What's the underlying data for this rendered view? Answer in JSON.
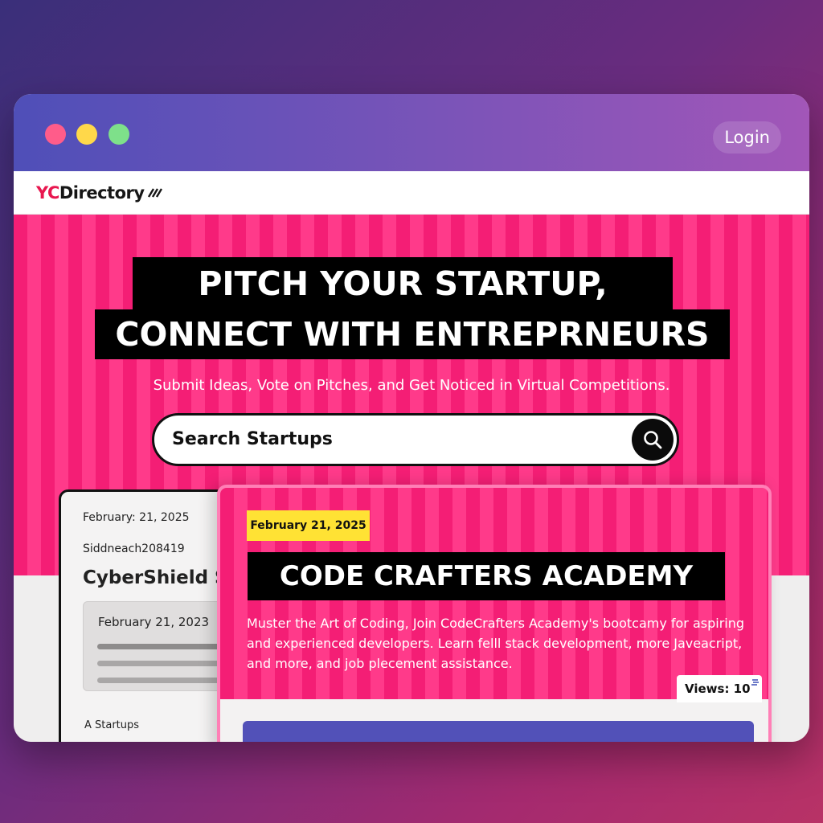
{
  "window": {
    "login_label": "Login"
  },
  "navbar": {
    "logo_yc": "YC",
    "logo_rest": "Directory"
  },
  "hero": {
    "headline_line1": "PITCH YOUR STARTUP,",
    "headline_line2": "CONNECT WITH ENTREPRNEURS",
    "subtitle": "Submit Ideas, Vote on Pitches, and Get Noticed in Virtual Competitions.",
    "search_placeholder": "Search Startups",
    "search_icon": "search-icon"
  },
  "cards": {
    "left": {
      "date": "February: 21, 2025",
      "author": "Siddneach208419",
      "title": "CyberShield S",
      "inner_date": "February 21, 2023",
      "footer": "A Startups"
    },
    "right": {
      "date": "February 21, 2025",
      "title": "CODE CRAFTERS ACADEMY",
      "description": "Muster the Art of Coding, Join CodeCrafters Academy's bootcamy for aspiring and experienced developers. Learn felll stack development, more Javeacript, and more, and job plecement assistance.",
      "views": "Views: 10"
    }
  },
  "colors": {
    "accent_pink": "#f7237a",
    "brand_red": "#e8174f",
    "date_yellow": "#ffe234",
    "titlebar_start": "#4f4fb8",
    "titlebar_end": "#a256b8"
  }
}
